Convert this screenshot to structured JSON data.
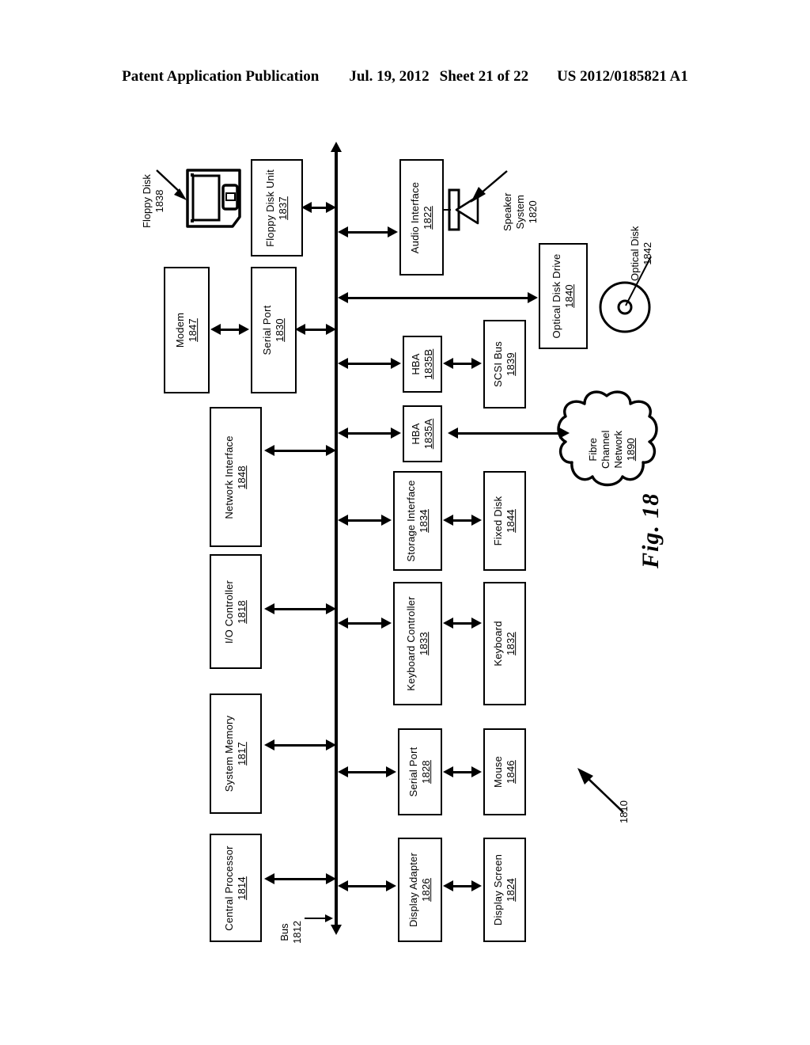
{
  "header": {
    "publication": "Patent Application Publication",
    "date": "Jul. 19, 2012",
    "sheet": "Sheet 21 of 22",
    "docnum": "US 2012/0185821 A1"
  },
  "figure": {
    "caption": "Fig. 18",
    "system_ref": "1810",
    "bus": {
      "label": "Bus",
      "num": "1812"
    }
  },
  "blocks": {
    "central_processor": {
      "label": "Central Processor",
      "num": "1814"
    },
    "system_memory": {
      "label": "System Memory",
      "num": "1817"
    },
    "io_controller": {
      "label": "I/O Controller",
      "num": "1818"
    },
    "network_interface": {
      "label": "Network Interface",
      "num": "1848"
    },
    "serial_port_1830": {
      "label": "Serial Port",
      "num": "1830"
    },
    "modem": {
      "label": "Modem",
      "num": "1847"
    },
    "floppy_disk_unit": {
      "label": "Floppy Disk Unit",
      "num": "1837"
    },
    "audio_interface": {
      "label": "Audio Interface",
      "num": "1822"
    },
    "optical_disk_drive": {
      "label": "Optical Disk Drive",
      "num": "1840"
    },
    "hba_b": {
      "label": "HBA",
      "num": "1835B"
    },
    "scsi_bus": {
      "label": "SCSI Bus",
      "num": "1839"
    },
    "hba_a": {
      "label": "HBA",
      "num": "1835A"
    },
    "storage_interface": {
      "label": "Storage Interface",
      "num": "1834"
    },
    "fixed_disk": {
      "label": "Fixed Disk",
      "num": "1844"
    },
    "keyboard_controller": {
      "label": "Keyboard Controller",
      "num": "1833"
    },
    "keyboard": {
      "label": "Keyboard",
      "num": "1832"
    },
    "serial_port_1828": {
      "label": "Serial Port",
      "num": "1828"
    },
    "mouse": {
      "label": "Mouse",
      "num": "1846"
    },
    "display_adapter": {
      "label": "Display Adapter",
      "num": "1826"
    },
    "display_screen": {
      "label": "Display Screen",
      "num": "1824"
    },
    "fibre_channel": {
      "line1": "Fibre",
      "line2": "Channel",
      "line3": "Network",
      "num": "1890"
    }
  },
  "callouts": {
    "floppy_disk": {
      "label": "Floppy Disk",
      "num": "1838"
    },
    "speaker": {
      "line1": "Speaker",
      "line2": "System",
      "num": "1820"
    },
    "optical_disk": {
      "label": "Optical Disk",
      "num": "1842"
    }
  },
  "colors": {
    "ink": "#000000",
    "paper": "#ffffff"
  }
}
